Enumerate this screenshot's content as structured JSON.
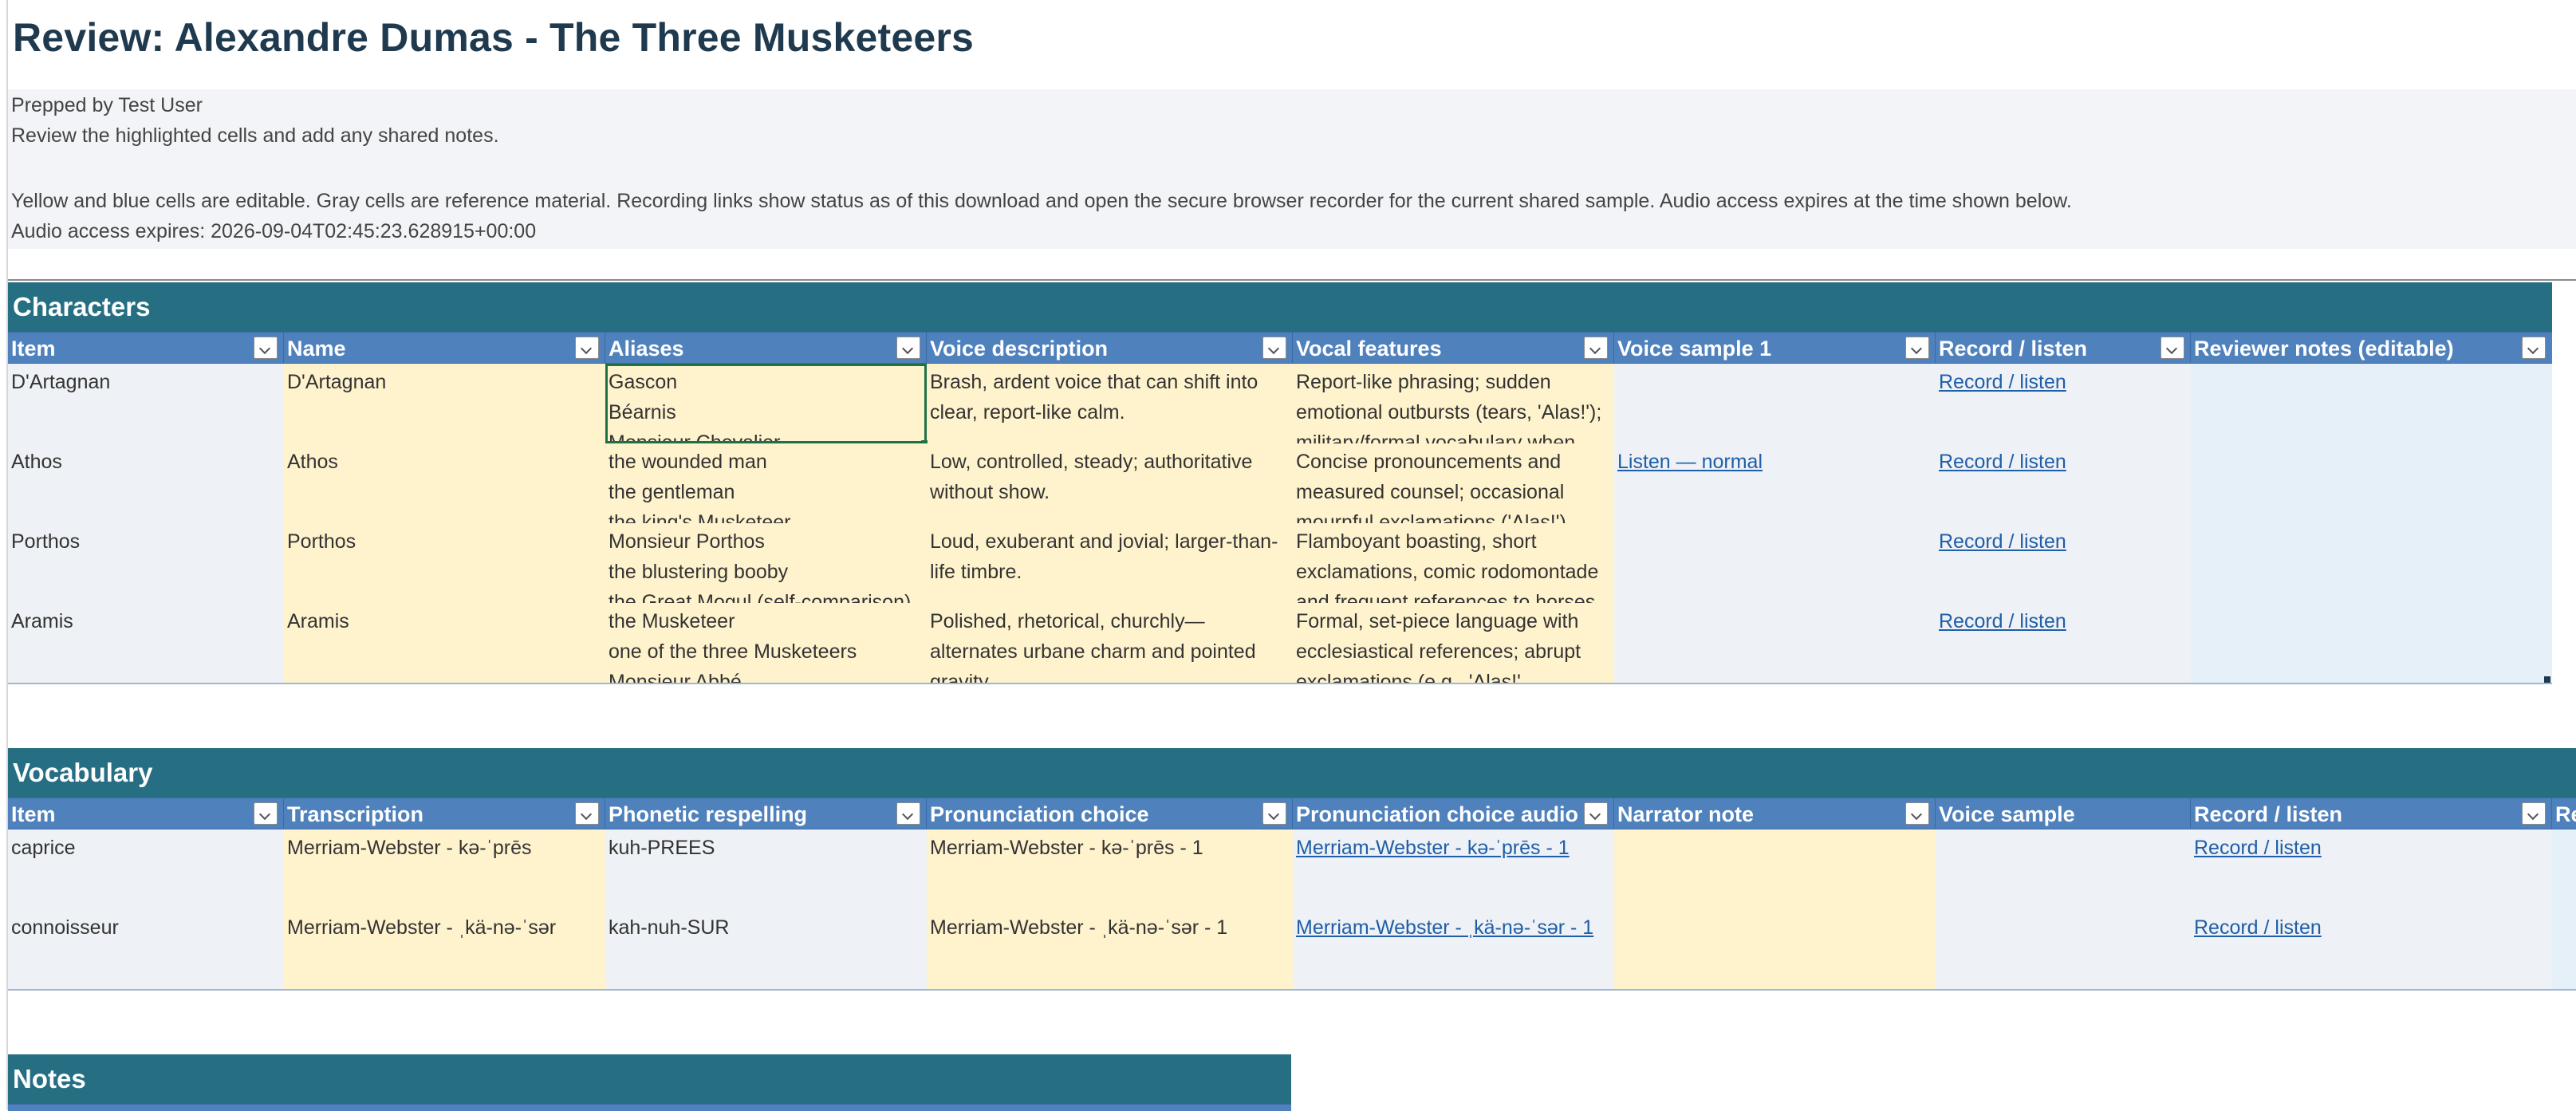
{
  "title": "Review: Alexandre Dumas - The Three Musketeers",
  "info": {
    "prepped_by": "Prepped by Test User",
    "instruction": "Review the highlighted cells and add any shared notes.",
    "legend": "Yellow and blue cells are editable. Gray cells are reference material. Recording links show status as of this download and open the secure browser recorder for the current shared sample. Audio access expires at the time shown below.",
    "expires": "Audio access expires: 2026-09-04T02:45:23.628915+00:00"
  },
  "characters": {
    "section_title": "Characters",
    "headers": [
      "Item",
      "Name",
      "Aliases",
      "Voice description",
      "Vocal features",
      "Voice sample 1",
      "Record / listen",
      "Reviewer notes (editable)"
    ],
    "rows": [
      {
        "item": "D'Artagnan",
        "name": "D'Artagnan",
        "aliases": [
          "Gascon",
          "Béarnis",
          "Monsieur Chevalier"
        ],
        "voice_description": "Brash, ardent voice that can shift into clear, report-like calm.",
        "vocal_features": "Report-like phrasing; sudden emotional outbursts (tears, 'Alas!'); military/formal vocabulary when",
        "voice_sample": "",
        "record": "Record / listen",
        "notes": ""
      },
      {
        "item": "Athos",
        "name": "Athos",
        "aliases": [
          "the wounded man",
          "the gentleman",
          "the king's Musketeer"
        ],
        "voice_description": "Low, controlled, steady; authoritative without show.",
        "vocal_features": "Concise pronouncements and measured counsel; occasional mournful exclamations ('Alas!')",
        "voice_sample": "Listen — normal",
        "record": "Record / listen",
        "notes": ""
      },
      {
        "item": "Porthos",
        "name": "Porthos",
        "aliases": [
          "Monsieur Porthos",
          "the blustering booby",
          "the Great Mogul (self-comparison)"
        ],
        "voice_description": "Loud, exuberant and jovial; larger-than-life timbre.",
        "vocal_features": "Flamboyant boasting, short exclamations, comic rodomontade and frequent references to horses",
        "voice_sample": "",
        "record": "Record / listen",
        "notes": ""
      },
      {
        "item": "Aramis",
        "name": "Aramis",
        "aliases": [
          "the Musketeer",
          "one of the three Musketeers",
          "Monsieur Abbé"
        ],
        "voice_description": "Polished, rhetorical, churchly—alternates urbane charm and pointed gravity.",
        "vocal_features": "Formal, set-piece language with ecclesiastical references; abrupt exclamations (e.g., 'Alas!'",
        "voice_sample": "",
        "record": "Record / listen",
        "notes": ""
      }
    ]
  },
  "vocabulary": {
    "section_title": "Vocabulary",
    "headers": [
      "Item",
      "Transcription",
      "Phonetic respelling",
      "Pronunciation choice",
      "Pronunciation choice audio",
      "Narrator note",
      "Voice sample",
      "Record / listen",
      "Re"
    ],
    "rows": [
      {
        "item": "caprice",
        "transcription": "Merriam-Webster - kə-ˈprēs",
        "respelling": "kuh-PREES",
        "choice": "Merriam-Webster - kə-ˈprēs - 1",
        "choice_audio": "Merriam-Webster - kə-ˈprēs - 1",
        "narrator_note": "",
        "voice_sample": "",
        "record": "Record / listen"
      },
      {
        "item": "connoisseur",
        "transcription": "Merriam-Webster - ˌkä-nə-ˈsər",
        "respelling": "kah-nuh-SUR",
        "choice": "Merriam-Webster - ˌkä-nə-ˈsər - 1",
        "choice_audio": "Merriam-Webster - ˌkä-nə-ˈsər - 1",
        "narrator_note": "",
        "voice_sample": "",
        "record": "Record / listen"
      }
    ]
  },
  "notes": {
    "section_title": "Notes"
  },
  "colors": {
    "section_bar": "#266f83",
    "header_row": "#4f81bd",
    "reference_cell": "#eef1f5",
    "editable_yellow": "#fff3cd",
    "editable_blue": "#e6f0f9",
    "link": "#1f5ea8"
  }
}
